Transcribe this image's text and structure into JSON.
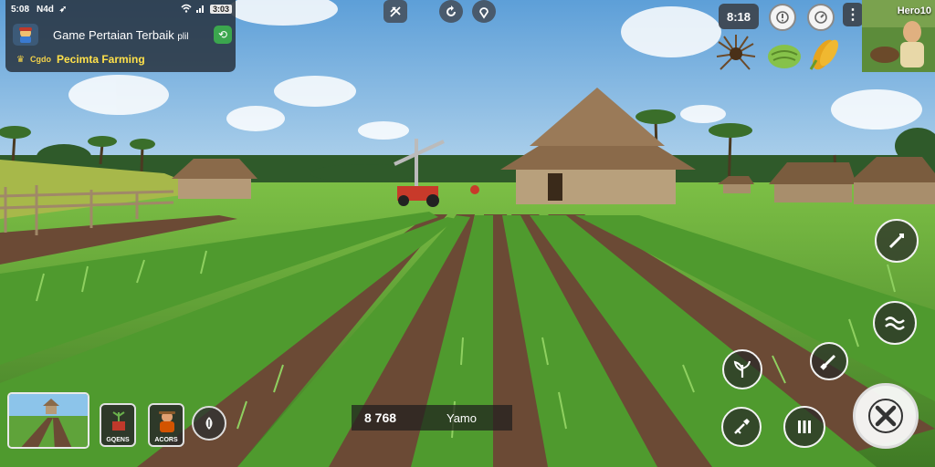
{
  "status_bar": {
    "time": "5:08",
    "carrier": "N4d",
    "icon": "location-arrow-icon",
    "battery": "3:03"
  },
  "notification": {
    "title": "Game Pertaian Terbaik",
    "title_suffix": "plil",
    "toggle_icon": "link-icon",
    "tag": "Cgdo",
    "subtitle": "Pecimta Farming"
  },
  "top_center_icons": [
    "fork-icon",
    "refresh-icon",
    "location-pin-icon"
  ],
  "hud": {
    "counter": "8:18",
    "round_buttons": [
      "info-icon",
      "timer-icon"
    ],
    "more_icon": "more-vertical-icon",
    "inventory": [
      {
        "name": "seed-bundle-icon",
        "color": "#6b4a2a"
      },
      {
        "name": "melon-icon",
        "color": "#86c24a"
      },
      {
        "name": "corn-icon",
        "color": "#e6a41e"
      }
    ],
    "portrait_label": "Hero10"
  },
  "bottom_left": {
    "tool_cards": [
      {
        "label": "GQENS",
        "icon": "sprout-pot-icon"
      },
      {
        "label": "ACORS",
        "icon": "farmer-icon"
      }
    ],
    "round_button_icon": "seed-icon"
  },
  "info_bar": {
    "value": "8 768",
    "label": "Yamo"
  },
  "actions": [
    {
      "name": "sickle-icon"
    },
    {
      "name": "wave-icon"
    },
    {
      "name": "plant-icon"
    },
    {
      "name": "brush-icon"
    },
    {
      "name": "shovel-icon"
    },
    {
      "name": "pause-icon"
    },
    {
      "name": "close-icon"
    }
  ],
  "colors": {
    "sky": "#7fb6e0",
    "field_green": "#5fa33a",
    "soil": "#6b4a35",
    "panel": "#28323e",
    "accent_yellow": "#ffe14a",
    "toggle_green": "#3ba64e"
  }
}
